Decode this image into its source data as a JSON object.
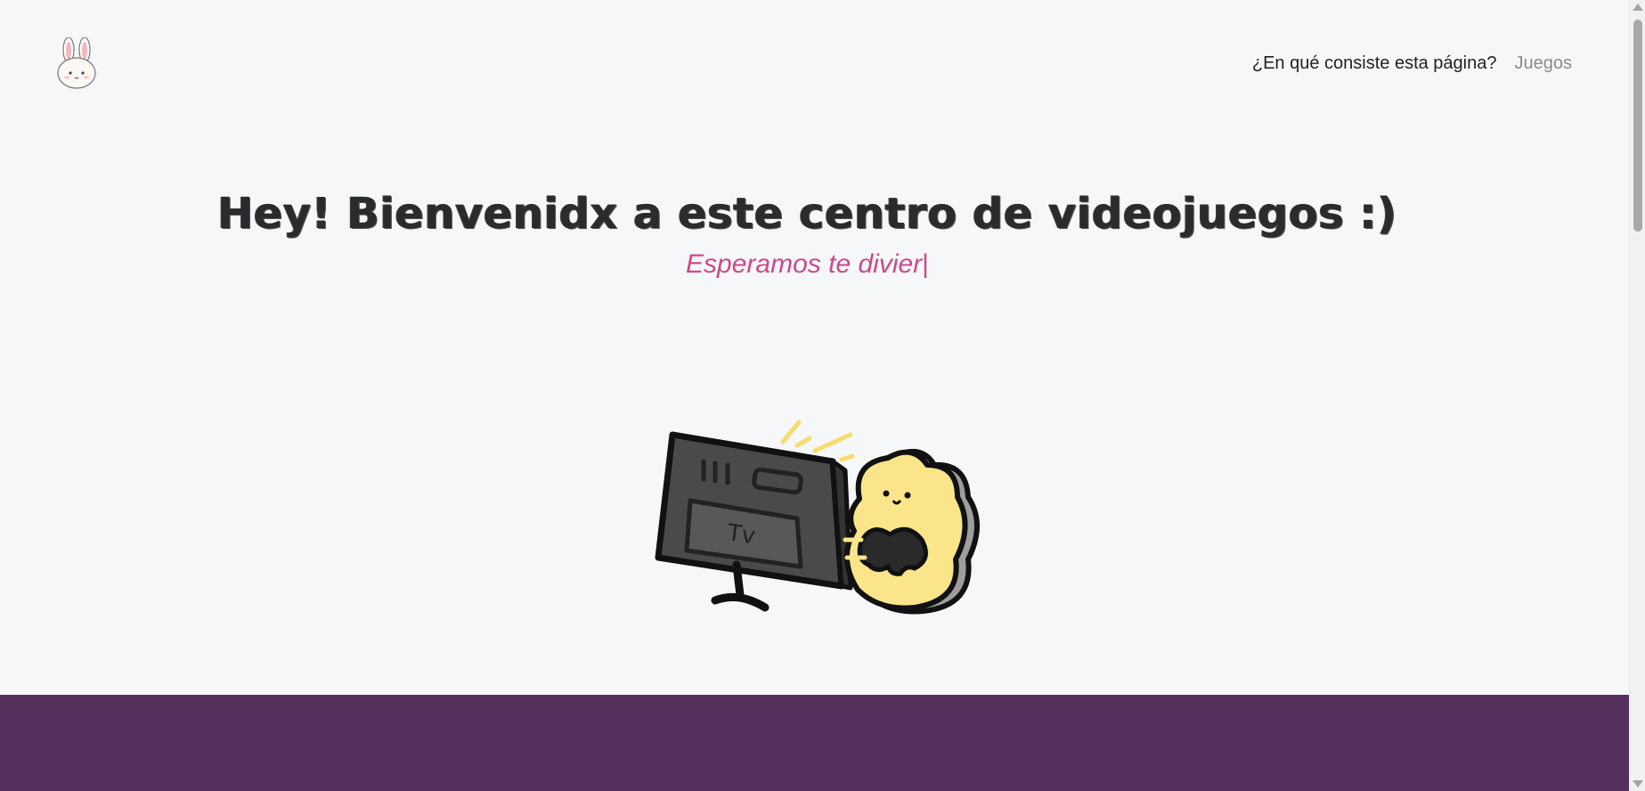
{
  "header": {
    "logo_icon": "bunny-logo-icon",
    "nav": [
      {
        "label": "¿En qué consiste esta página?"
      },
      {
        "label": "Juegos"
      }
    ]
  },
  "hero": {
    "title": "Hey! Bienvenidx a este centro de videojuegos :)",
    "subtitle": "Esperamos te divier",
    "caret": "|",
    "illustration_icon": "tv-and-gamer-illustration"
  },
  "colors": {
    "background": "#f6f7f9",
    "accent_pink": "#c94a8a",
    "footer_purple": "#55305d"
  }
}
